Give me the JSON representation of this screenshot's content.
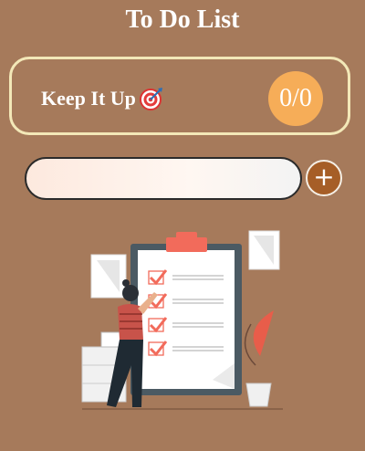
{
  "header": {
    "title": "To Do List"
  },
  "progress_card": {
    "message": "Keep It Up",
    "message_icon": "target-icon",
    "completed": 0,
    "total": 0,
    "counter_text": "0/0"
  },
  "task_entry": {
    "value": "",
    "placeholder": "",
    "add_label": "+"
  },
  "illustration": {
    "icon": "checklist-illustration"
  },
  "colors": {
    "background": "#a67a5b",
    "card_border": "#f3e8b8",
    "counter_bg": "#f6ad58",
    "add_button_bg": "#a65e27"
  }
}
